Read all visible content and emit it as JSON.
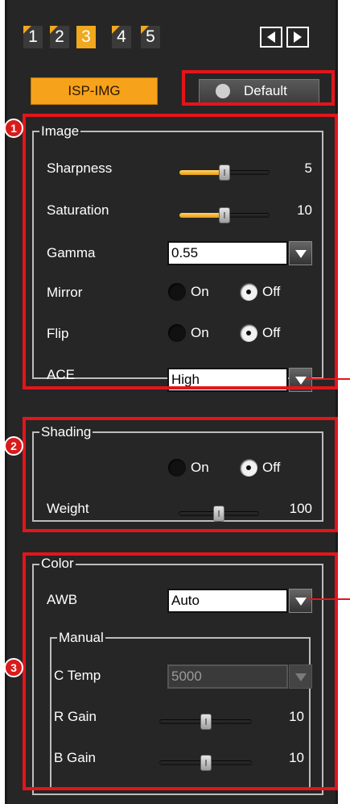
{
  "tabs": [
    {
      "label": "1",
      "active": false
    },
    {
      "label": "2",
      "active": false
    },
    {
      "label": "3",
      "active": true
    },
    {
      "label": "4",
      "active": false
    },
    {
      "label": "5",
      "active": false
    }
  ],
  "nav": {
    "prev_icon": "triangle-left-icon",
    "next_icon": "triangle-right-icon"
  },
  "toolbar": {
    "isp_img_label": "ISP-IMG",
    "default_label": "Default",
    "default_icon": "reset-icon"
  },
  "badges": [
    "1",
    "2",
    "3"
  ],
  "image": {
    "title": "Image",
    "sharpness": {
      "label": "Sharpness",
      "value": "5",
      "fraction": 0.5
    },
    "saturation": {
      "label": "Saturation",
      "value": "10",
      "fraction": 0.5
    },
    "gamma": {
      "label": "Gamma",
      "value": "0.55"
    },
    "mirror": {
      "label": "Mirror",
      "on": "On",
      "off": "Off",
      "selected": "Off"
    },
    "flip": {
      "label": "Flip",
      "on": "On",
      "off": "Off",
      "selected": "Off"
    },
    "ace": {
      "label": "ACE",
      "value": "High"
    }
  },
  "shading": {
    "title": "Shading",
    "on": "On",
    "off": "Off",
    "selected": "Off",
    "weight": {
      "label": "Weight",
      "value": "100",
      "fraction": 0.5
    }
  },
  "color": {
    "title": "Color",
    "awb": {
      "label": "AWB",
      "value": "Auto"
    },
    "manual": {
      "title": "Manual",
      "ctemp": {
        "label": "C Temp",
        "value": "5000",
        "disabled": true
      },
      "rgain": {
        "label": "R Gain",
        "value": "10",
        "fraction": 0.5
      },
      "bgain": {
        "label": "B Gain",
        "value": "10",
        "fraction": 0.5
      }
    }
  },
  "colors": {
    "accent": "#f6a21a",
    "highlight": "#e5141b",
    "panel": "#262626"
  }
}
